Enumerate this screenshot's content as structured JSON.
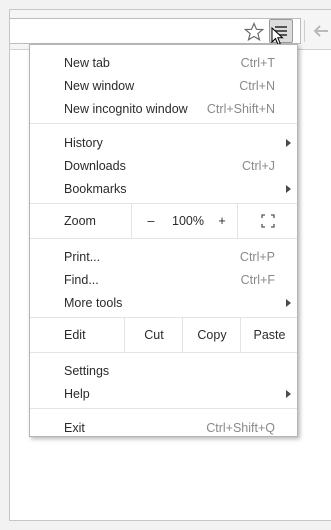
{
  "browser": {
    "star_icon": "bookmark-star-icon",
    "menu_icon": "hamburger-menu-icon",
    "back_icon": "arrow-back-icon"
  },
  "menu": {
    "new_tab": {
      "label": "New tab",
      "shortcut": "Ctrl+T"
    },
    "new_window": {
      "label": "New window",
      "shortcut": "Ctrl+N"
    },
    "new_incognito": {
      "label": "New incognito window",
      "shortcut": "Ctrl+Shift+N"
    },
    "history": {
      "label": "History"
    },
    "downloads": {
      "label": "Downloads",
      "shortcut": "Ctrl+J"
    },
    "bookmarks": {
      "label": "Bookmarks"
    },
    "zoom": {
      "label": "Zoom",
      "minus": "–",
      "value": "100%",
      "plus": "+"
    },
    "print": {
      "label": "Print...",
      "shortcut": "Ctrl+P"
    },
    "find": {
      "label": "Find...",
      "shortcut": "Ctrl+F"
    },
    "more_tools": {
      "label": "More tools"
    },
    "edit": {
      "label": "Edit",
      "cut": "Cut",
      "copy": "Copy",
      "paste": "Paste"
    },
    "settings": {
      "label": "Settings"
    },
    "help": {
      "label": "Help"
    },
    "exit": {
      "label": "Exit",
      "shortcut": "Ctrl+Shift+Q"
    }
  }
}
